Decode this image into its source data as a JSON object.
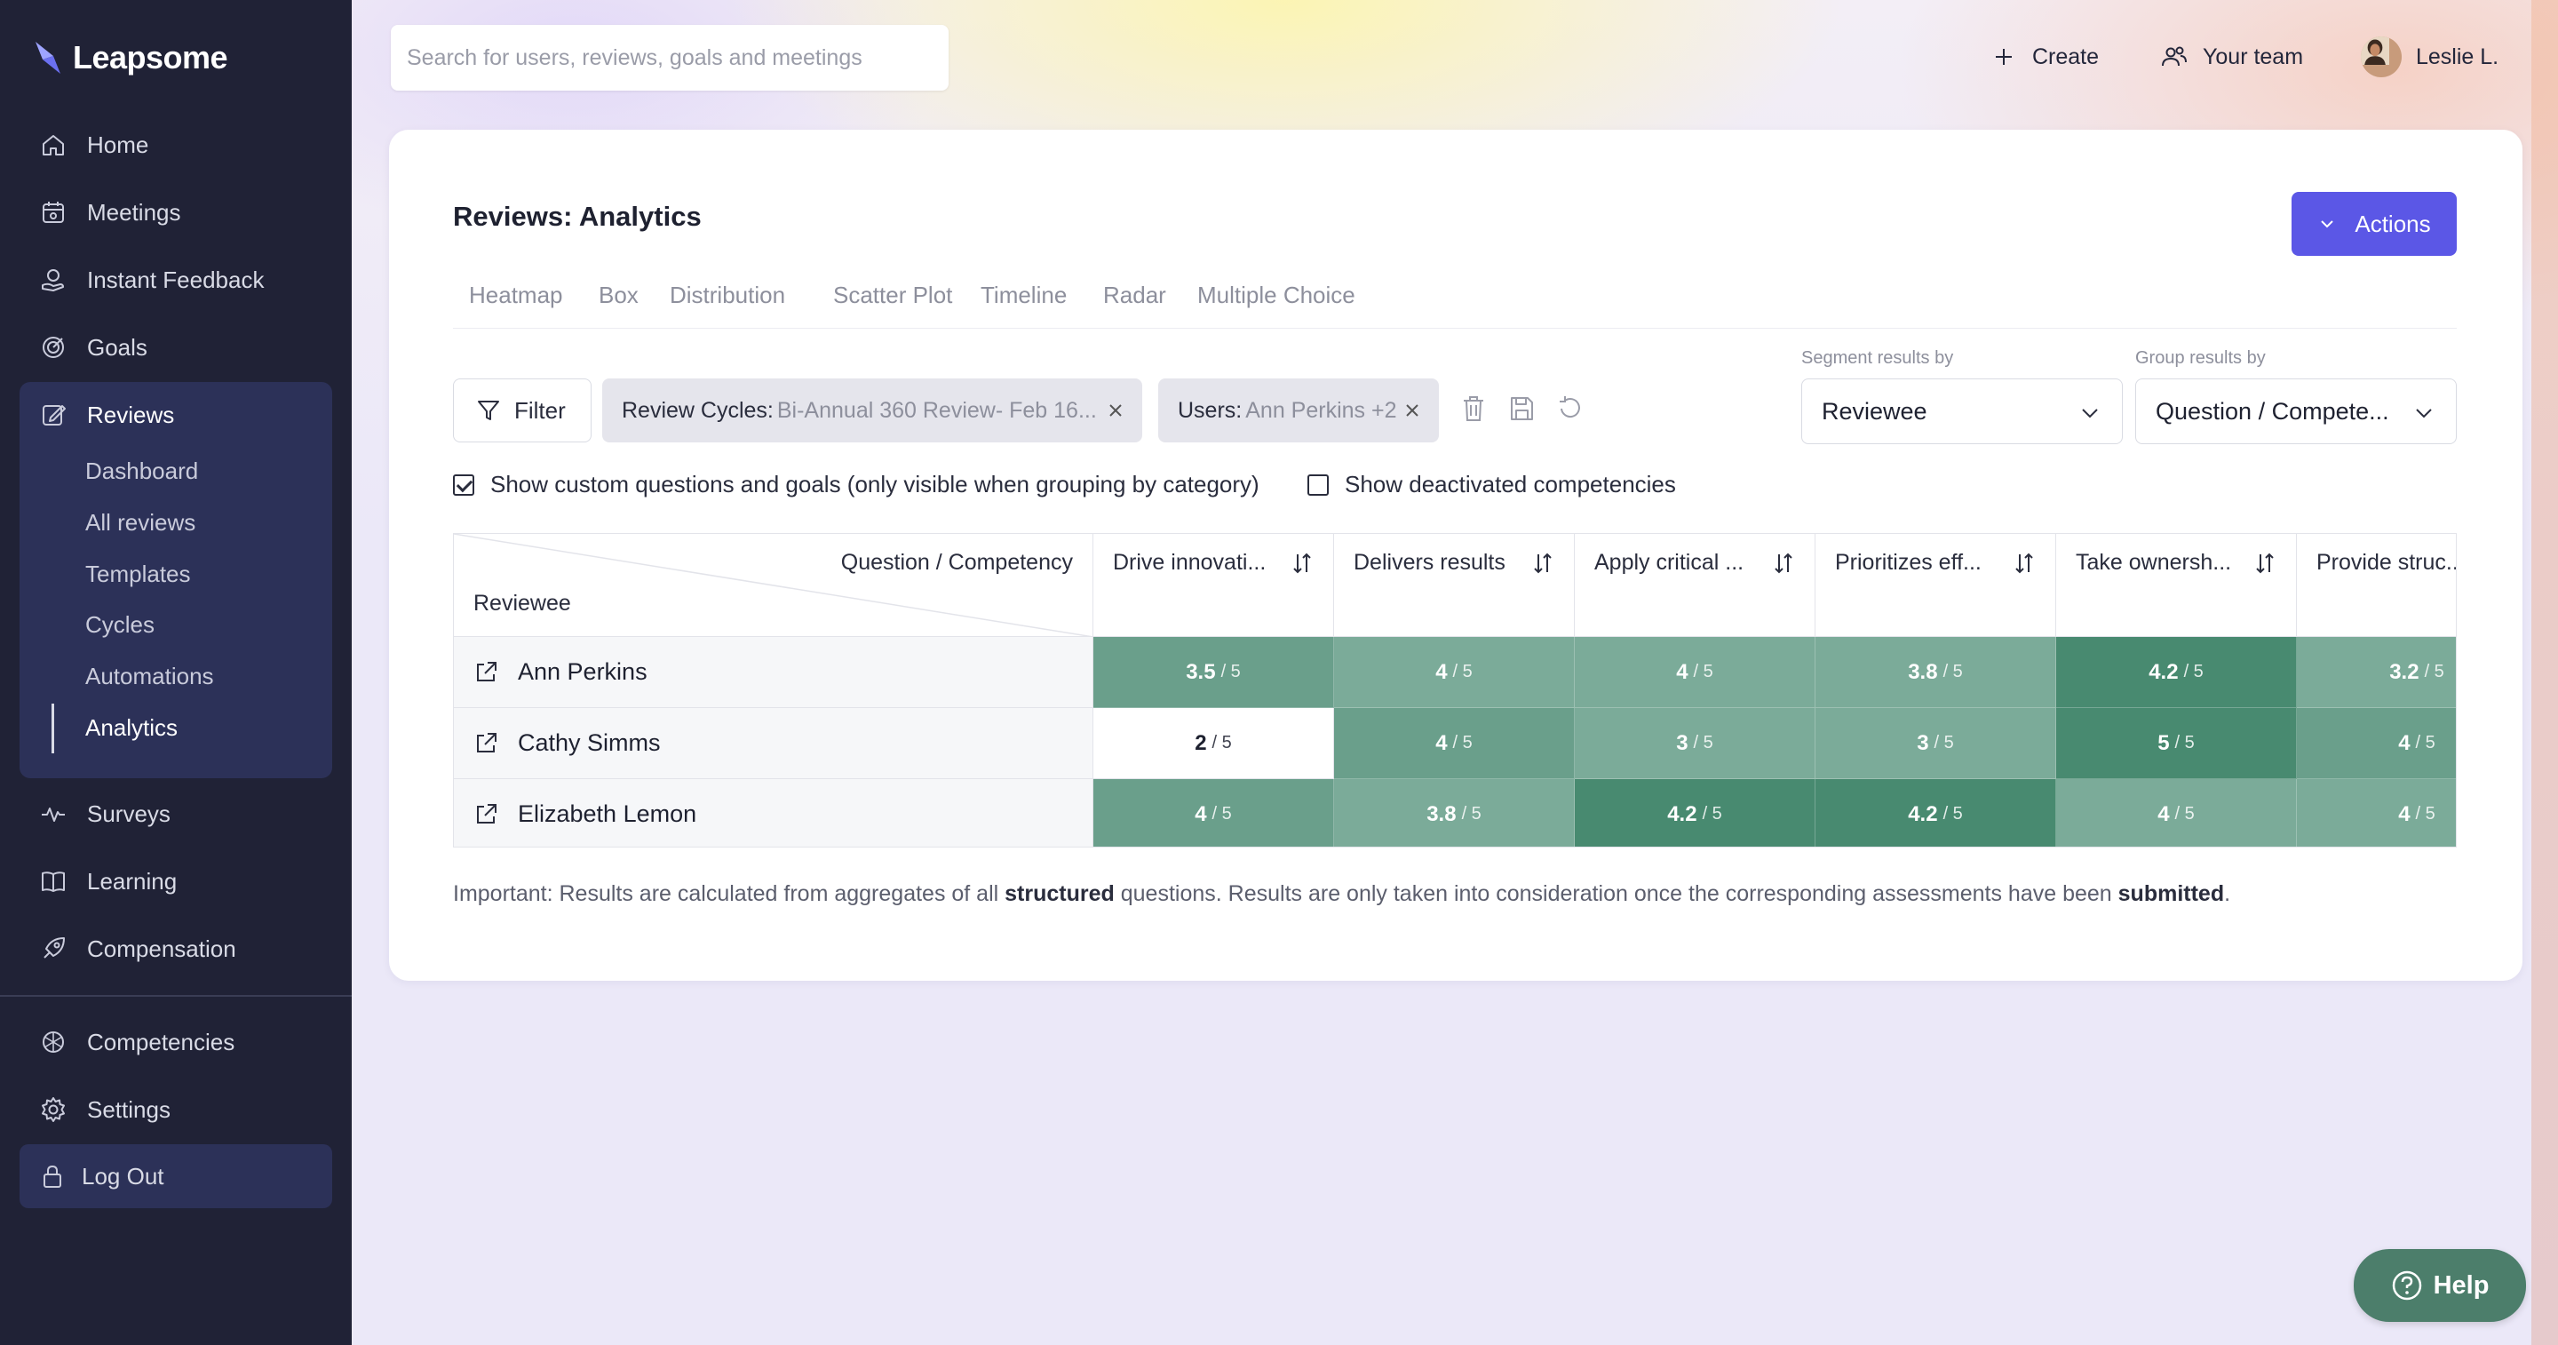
{
  "app": {
    "name": "Leapsome"
  },
  "sidebar": {
    "items": [
      {
        "label": "Home",
        "icon": "home-icon"
      },
      {
        "label": "Meetings",
        "icon": "meetings-icon"
      },
      {
        "label": "Instant Feedback",
        "icon": "feedback-icon"
      },
      {
        "label": "Goals",
        "icon": "goals-icon"
      },
      {
        "label": "Reviews",
        "icon": "reviews-icon"
      },
      {
        "label": "Surveys",
        "icon": "surveys-icon"
      },
      {
        "label": "Learning",
        "icon": "learning-icon"
      },
      {
        "label": "Compensation",
        "icon": "compensation-icon"
      },
      {
        "label": "Competencies",
        "icon": "competencies-icon"
      },
      {
        "label": "Settings",
        "icon": "gear-icon"
      }
    ],
    "reviews_sub": [
      "Dashboard",
      "All reviews",
      "Templates",
      "Cycles",
      "Automations",
      "Analytics"
    ],
    "active_sub": "Analytics",
    "logout": "Log Out"
  },
  "topbar": {
    "search_placeholder": "Search for users, reviews, goals and meetings",
    "create": "Create",
    "your_team": "Your team",
    "user": "Leslie L."
  },
  "page": {
    "title": "Reviews: Analytics",
    "actions": "Actions",
    "tabs": [
      "Heatmap",
      "Box",
      "Distribution",
      "Scatter Plot",
      "Timeline",
      "Radar",
      "Multiple Choice"
    ],
    "filter": "Filter",
    "chips": [
      {
        "label": "Review Cycles:",
        "value": "Bi-Annual 360 Review- Feb 16..."
      },
      {
        "label": "Users:",
        "value": "Ann Perkins +2"
      }
    ],
    "segment": {
      "label": "Segment results by",
      "value": "Reviewee"
    },
    "group": {
      "label": "Group results by",
      "value": "Question / Compete..."
    },
    "check_custom": "Show custom questions and goals (only visible when grouping by category)",
    "check_deactivated": "Show deactivated competencies",
    "note": {
      "pre": "Important: Results are calculated from aggregates of all ",
      "b1": "structured",
      "mid": " questions. Results are only taken into consideration once the corresponding assessments have been ",
      "b2": "submitted",
      "post": "."
    }
  },
  "table": {
    "corner_col": "Question / Competency",
    "corner_row": "Reviewee",
    "columns": [
      "Drive innovati...",
      "Delivers results",
      "Apply critical ...",
      "Prioritizes eff...",
      "Take ownersh...",
      "Provide struc..."
    ],
    "denominator": "/ 5",
    "rows": [
      {
        "name": "Ann Perkins",
        "values": [
          "3.5",
          "4",
          "4",
          "3.8",
          "4.2",
          "3.2"
        ]
      },
      {
        "name": "Cathy Simms",
        "values": [
          "2",
          "4",
          "3",
          "3",
          "5",
          "4"
        ]
      },
      {
        "name": "Elizabeth Lemon",
        "values": [
          "4",
          "3.8",
          "4.2",
          "4.2",
          "4",
          "4"
        ]
      }
    ],
    "colors": {
      "white": "#ffffff",
      "light": "#7bab99",
      "medium": "#6a9f8b",
      "mid": "#5a937d",
      "dark": "#488a70"
    },
    "cell_shades": [
      [
        "medium",
        "light",
        "light",
        "light",
        "dark",
        "light"
      ],
      [
        "white",
        "medium",
        "light",
        "light",
        "dark",
        "medium"
      ],
      [
        "medium",
        "light",
        "dark",
        "dark",
        "light",
        "light"
      ]
    ]
  },
  "help": "Help"
}
